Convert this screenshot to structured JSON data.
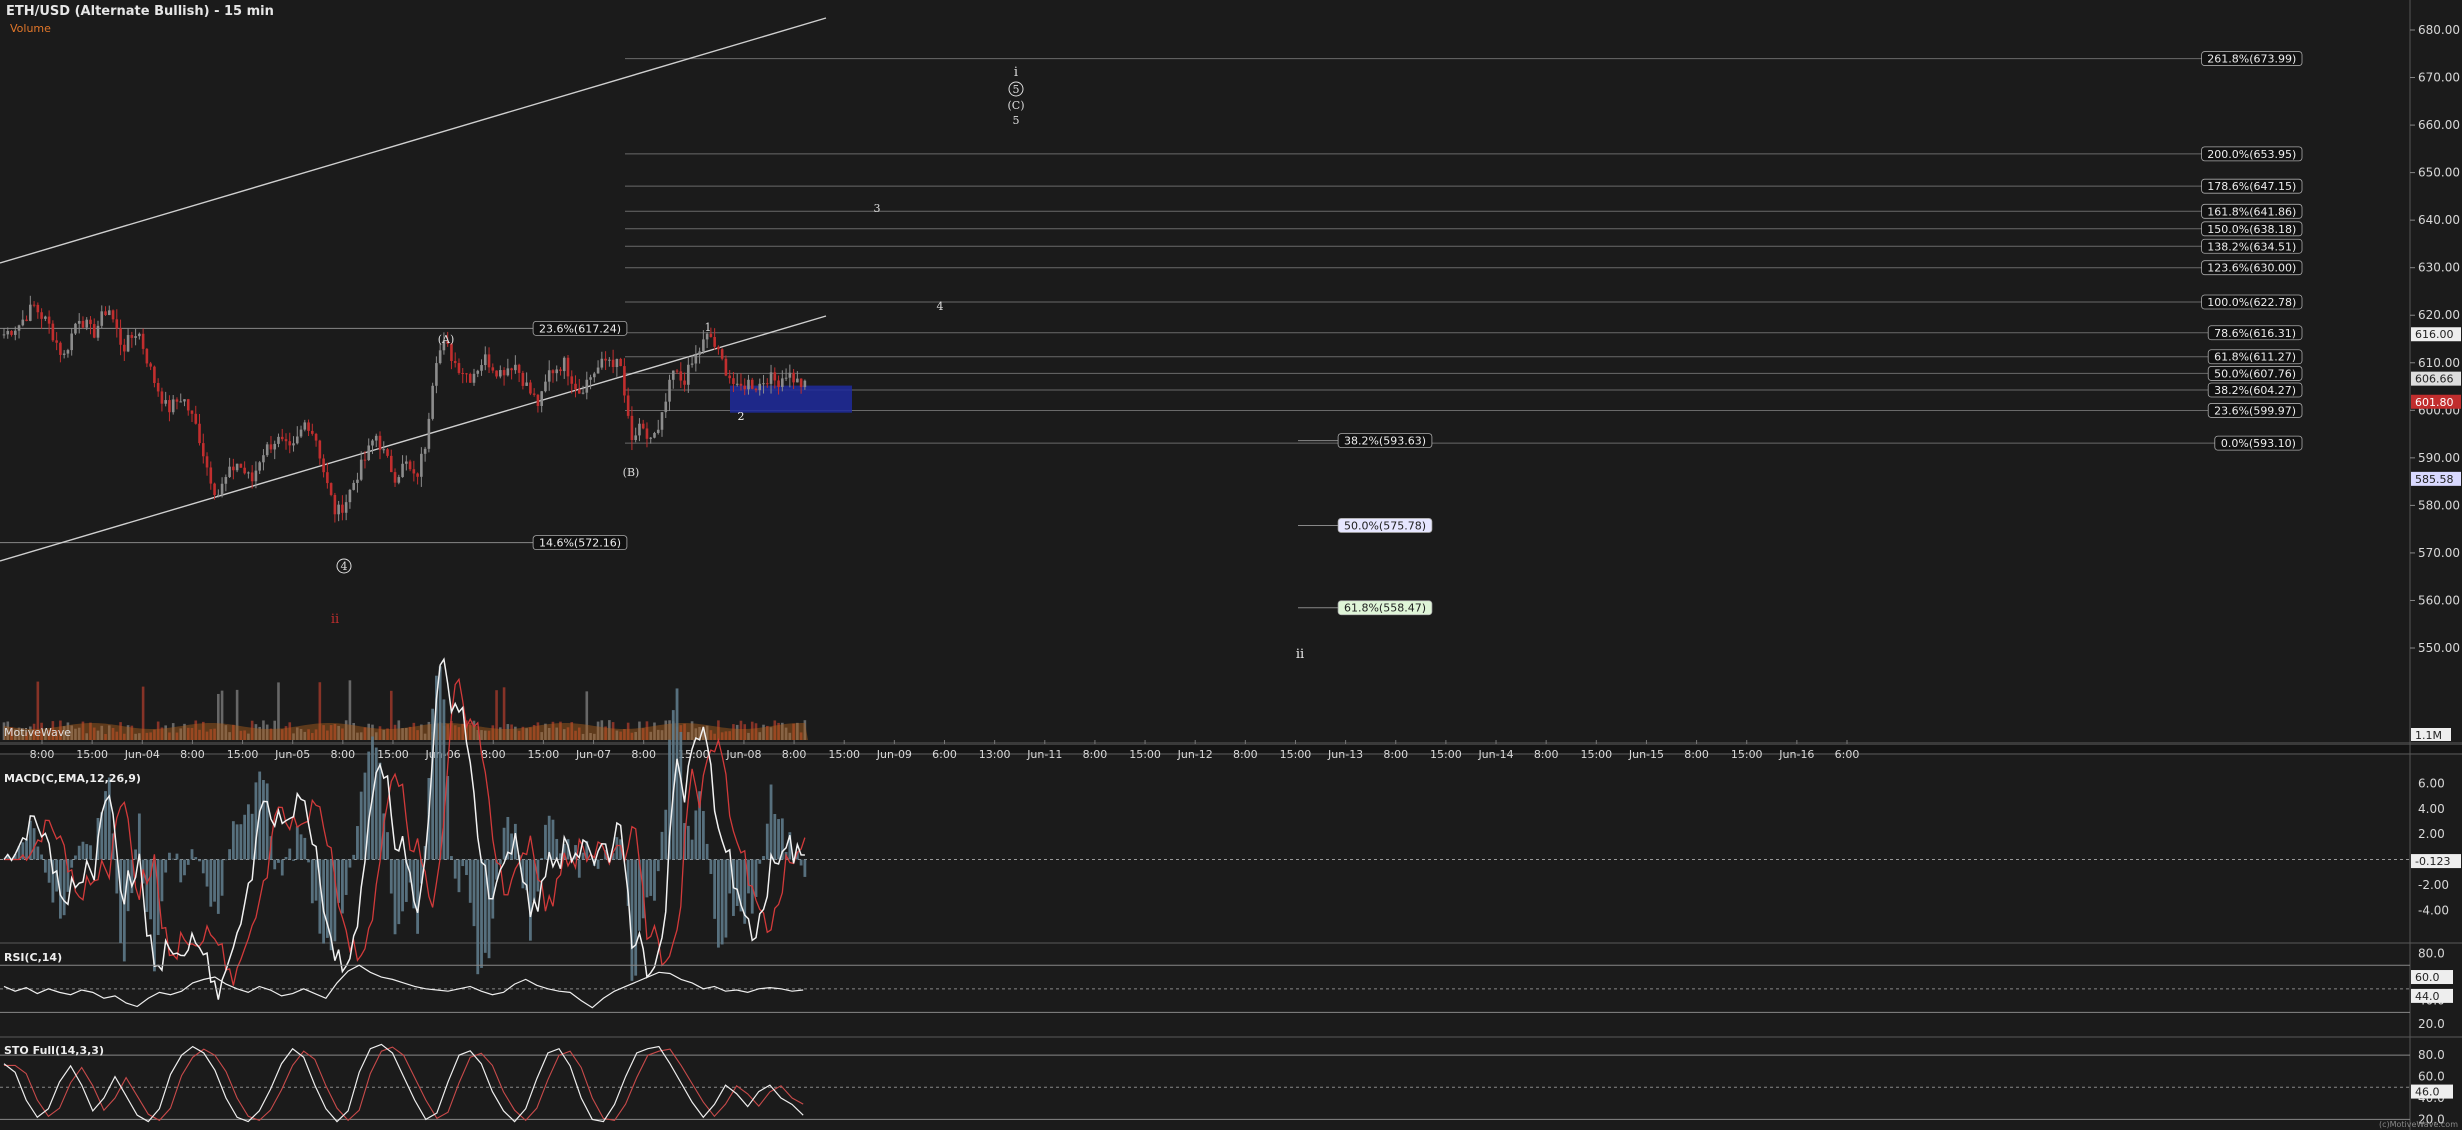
{
  "title": "ETH/USD (Alternate Bullish) - 15 min",
  "volume_label": "Volume",
  "watermark": "MotiveWave",
  "footer": "(c)MotiveWave.com",
  "colors": {
    "background": "#1b1b1b",
    "up": "#8c8c8c",
    "down": "#c12e2e",
    "axis_text": "#d8d8d8",
    "fib_line": "#6a6a6a",
    "box": "#1f2a9c",
    "red_label": "#c12e2e"
  },
  "chart_data": [
    {
      "type": "candlestick",
      "title": "ETH/USD (Alternate Bullish) - 15 min",
      "y_ticks": [
        "680.00",
        "670.00",
        "660.00",
        "650.00",
        "640.00",
        "630.00",
        "620.00",
        "610.00",
        "600.00",
        "590.00",
        "580.00",
        "570.00",
        "560.00",
        "550.00"
      ],
      "ylim": [
        546,
        684
      ],
      "x_ticks": [
        "8:00",
        "15:00",
        "Jun-04",
        "8:00",
        "15:00",
        "Jun-05",
        "8:00",
        "15:00",
        "Jun-06",
        "8:00",
        "15:00",
        "Jun-07",
        "8:00",
        "15:00",
        "Jun-08",
        "8:00",
        "15:00",
        "Jun-09",
        "6:00",
        "13:00",
        "Jun-11",
        "8:00",
        "15:00",
        "Jun-12",
        "8:00",
        "15:00",
        "Jun-13",
        "8:00",
        "15:00",
        "Jun-14",
        "8:00",
        "15:00",
        "Jun-15",
        "8:00",
        "15:00",
        "Jun-16",
        "6:00"
      ],
      "price_path": [
        [
          0,
          616
        ],
        [
          15,
          618
        ],
        [
          30,
          622
        ],
        [
          45,
          618
        ],
        [
          60,
          611
        ],
        [
          75,
          620
        ],
        [
          90,
          616
        ],
        [
          105,
          622
        ],
        [
          120,
          613
        ],
        [
          135,
          617
        ],
        [
          150,
          607
        ],
        [
          165,
          600
        ],
        [
          180,
          603
        ],
        [
          195,
          596
        ],
        [
          205,
          588
        ],
        [
          215,
          582
        ],
        [
          225,
          586
        ],
        [
          235,
          589
        ],
        [
          250,
          585
        ],
        [
          260,
          591
        ],
        [
          275,
          594
        ],
        [
          290,
          591
        ],
        [
          305,
          598
        ],
        [
          315,
          594
        ],
        [
          325,
          585
        ],
        [
          335,
          578
        ],
        [
          345,
          581
        ],
        [
          355,
          586
        ],
        [
          365,
          590
        ],
        [
          375,
          595
        ],
        [
          385,
          590
        ],
        [
          395,
          586
        ],
        [
          405,
          589
        ],
        [
          415,
          585
        ],
        [
          425,
          593
        ],
        [
          435,
          611
        ],
        [
          445,
          614
        ],
        [
          455,
          610
        ],
        [
          470,
          607
        ],
        [
          485,
          611
        ],
        [
          500,
          608
        ],
        [
          515,
          610
        ],
        [
          530,
          604
        ],
        [
          540,
          601
        ],
        [
          550,
          608
        ],
        [
          565,
          610
        ],
        [
          580,
          604
        ],
        [
          595,
          608
        ],
        [
          610,
          611
        ],
        [
          622,
          609
        ],
        [
          628,
          600
        ],
        [
          633,
          593
        ],
        [
          640,
          596
        ],
        [
          650,
          594
        ],
        [
          660,
          595
        ],
        [
          668,
          602
        ],
        [
          675,
          608
        ],
        [
          685,
          606
        ],
        [
          695,
          610
        ],
        [
          705,
          614
        ],
        [
          712,
          616
        ],
        [
          720,
          612
        ],
        [
          730,
          608
        ],
        [
          740,
          604
        ],
        [
          750,
          606
        ],
        [
          760,
          605
        ],
        [
          770,
          607
        ],
        [
          780,
          606
        ],
        [
          790,
          608
        ],
        [
          800,
          606
        ],
        [
          808,
          605
        ]
      ],
      "horizontal_levels": [
        {
          "label": "261.8%(673.99)",
          "price": 673.99
        },
        {
          "label": "200.0%(653.95)",
          "price": 653.95
        },
        {
          "label": "178.6%(647.15)",
          "price": 647.15
        },
        {
          "label": "161.8%(641.86)",
          "price": 641.86
        },
        {
          "label": "150.0%(638.18)",
          "price": 638.18
        },
        {
          "label": "138.2%(634.51)",
          "price": 634.51
        },
        {
          "label": "123.6%(630.00)",
          "price": 630.0
        },
        {
          "label": "100.0%(622.78)",
          "price": 622.78
        },
        {
          "label": "78.6%(616.31)",
          "price": 616.31
        },
        {
          "label": "61.8%(611.27)",
          "price": 611.27
        },
        {
          "label": "50.0%(607.76)",
          "price": 607.76
        },
        {
          "label": "38.2%(604.27)",
          "price": 604.27
        },
        {
          "label": "23.6%(599.97)",
          "price": 599.97
        },
        {
          "label": "0.0%(593.10)",
          "price": 593.1
        }
      ],
      "retracements": [
        {
          "label": "23.6%(617.24)",
          "price": 617.24
        },
        {
          "label": "14.6%(572.16)",
          "price": 572.16
        },
        {
          "label": "38.2%(593.63)",
          "price": 593.63
        },
        {
          "label": "50.0%(575.78)",
          "price": 575.78
        },
        {
          "label": "61.8%(558.47)",
          "price": 558.47
        }
      ],
      "wave_labels": [
        "i",
        "5",
        "(C)",
        "5",
        "3",
        "4",
        "1",
        "2",
        "(A)",
        "(B)",
        "4",
        "ii",
        "ii"
      ],
      "price_flags": [
        "616.00",
        "606.66",
        "601.80",
        "585.58"
      ],
      "volume_flag": "1.1M"
    },
    {
      "type": "line",
      "title": "MACD(C,EMA,12,26,9)",
      "y_ticks": [
        "6.00",
        "4.00",
        "2.00",
        "-2.00",
        "-4.00"
      ],
      "ylim": [
        -6.5,
        8
      ],
      "value_flag": "-0.123"
    },
    {
      "type": "line",
      "title": "RSI(C,14)",
      "y_ticks": [
        "80.0",
        "60.0",
        "40.0",
        "20.0"
      ],
      "ylim": [
        10,
        88
      ],
      "value_flags": [
        "60.0",
        "44.0"
      ],
      "values": [
        52,
        48,
        51,
        46,
        50,
        47,
        45,
        49,
        47,
        42,
        44,
        38,
        35,
        42,
        47,
        45,
        48,
        55,
        58,
        60,
        54,
        50,
        47,
        52,
        49,
        44,
        46,
        50,
        46,
        42,
        55,
        65,
        70,
        64,
        60,
        58,
        55,
        52,
        50,
        49,
        48,
        50,
        52,
        48,
        45,
        47,
        54,
        58,
        53,
        50,
        48,
        47,
        40,
        34,
        42,
        48,
        52,
        56,
        60,
        64,
        63,
        58,
        55,
        50,
        52,
        48,
        49,
        47,
        50,
        51,
        50,
        48,
        49
      ]
    },
    {
      "type": "line",
      "title": "STO Full(14,3,3)",
      "y_ticks": [
        "80.0",
        "60.0",
        "40.0",
        "20.0"
      ],
      "ylim": [
        12,
        96
      ],
      "value_flag": "46.0",
      "values": [
        72,
        64,
        38,
        22,
        30,
        55,
        70,
        52,
        28,
        40,
        60,
        42,
        24,
        18,
        30,
        62,
        80,
        88,
        82,
        66,
        40,
        22,
        18,
        28,
        48,
        72,
        86,
        78,
        52,
        30,
        18,
        28,
        64,
        86,
        90,
        82,
        60,
        38,
        20,
        26,
        55,
        80,
        84,
        72,
        46,
        28,
        18,
        30,
        58,
        82,
        86,
        70,
        40,
        20,
        18,
        34,
        60,
        82,
        86,
        88,
        72,
        54,
        36,
        22,
        34,
        52,
        44,
        32,
        46,
        52,
        40,
        34,
        24
      ]
    }
  ]
}
